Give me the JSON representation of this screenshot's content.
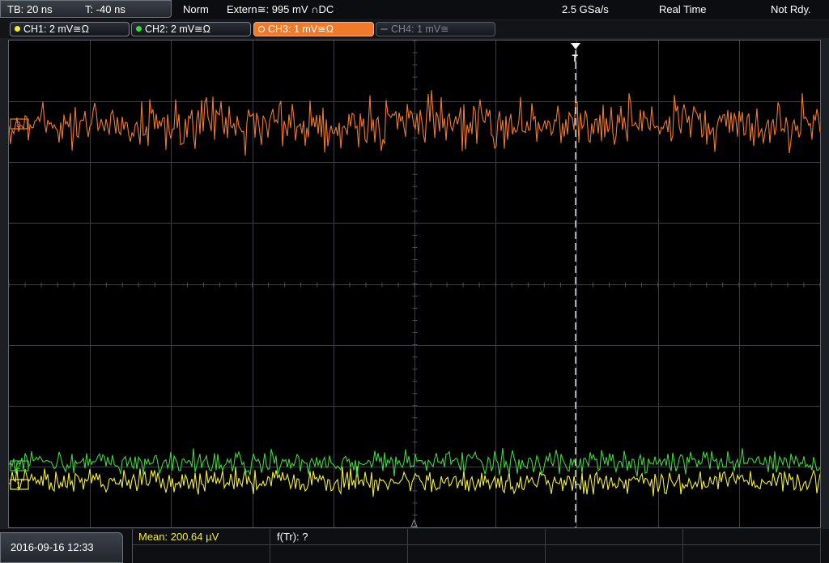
{
  "header": {
    "timebase": "TB: 20 ns",
    "trigger_time": "T: -40 ns",
    "acq_mode": "Norm",
    "trigger_source": "Extern≅: 995 mV ∩DC",
    "sample_rate": "2.5 GSa/s",
    "acq_type": "Real Time",
    "status": "Not Rdy."
  },
  "channels": [
    {
      "label": "CH1: 2 mV≅Ω",
      "color": "#f2ee3a",
      "state": "on"
    },
    {
      "label": "CH2: 2 mV≅Ω",
      "color": "#3ed63e",
      "state": "on"
    },
    {
      "label": "CH3: 1 mV≅Ω",
      "color": "#f07a2a",
      "state": "selected"
    },
    {
      "label": "CH4: 1 mV≅",
      "color": "#7d838a",
      "state": "off"
    }
  ],
  "screen": {
    "trigger_marker": "T",
    "ch1_marker": "1",
    "ch2_marker": "2",
    "ch3_marker": "3",
    "trace_colors": {
      "ch1": "#f2ee3a",
      "ch2": "#3ed63e",
      "ch3": "#f07a2a"
    }
  },
  "footer": {
    "datetime": "2016-09-16 12:33",
    "mean": "Mean: 200.64 µV",
    "frequency": "f(Tr): ?"
  }
}
